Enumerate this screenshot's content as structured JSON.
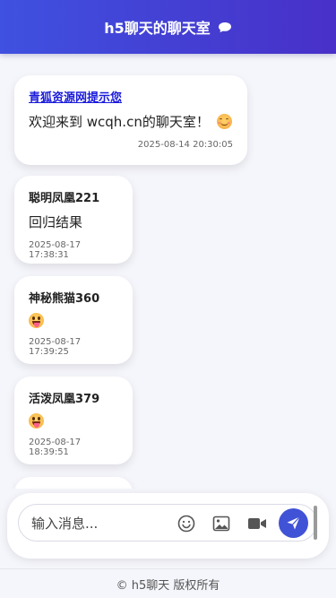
{
  "header": {
    "title": "h5聊天的聊天室",
    "icon": "chat-bubble-icon"
  },
  "messages": [
    {
      "sender": "青狐资源网提示您",
      "text": "欢迎来到 wcqh.cn的聊天室！",
      "emoji": "smiling-face-icon",
      "time": "2025-08-14 20:30:05"
    },
    {
      "sender": "聪明凤凰221",
      "text": "回归结果",
      "time": "2025-08-17 17:38:31"
    },
    {
      "sender": "神秘熊猫360",
      "emoji": "tongue-face-icon",
      "time": "2025-08-17 17:39:25"
    },
    {
      "sender": "活泼凤凰379",
      "emoji": "tongue-face-icon",
      "time": "2025-08-17 18:39:51"
    }
  ],
  "composer": {
    "placeholder": "输入消息...",
    "value": "",
    "buttons": [
      "emoji-picker-icon",
      "image-icon",
      "video-icon",
      "send-icon"
    ],
    "accent_color": "#4052d6"
  },
  "footer": {
    "text": "© h5聊天 版权所有"
  },
  "colors": {
    "header_gradient_start": "#3f51e0",
    "header_gradient_end": "#4830c8",
    "link_color": "#1a1adb"
  }
}
